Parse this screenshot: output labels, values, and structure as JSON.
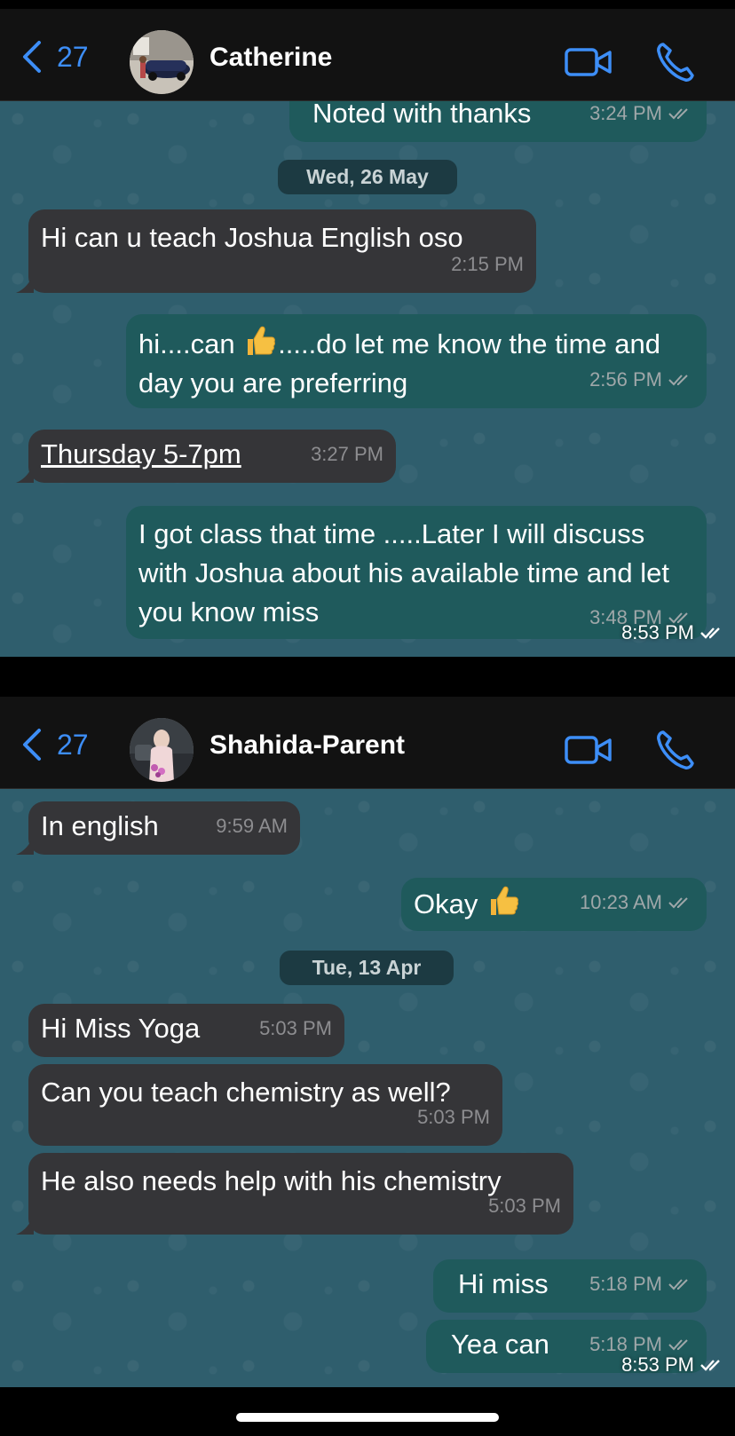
{
  "colors": {
    "accent": "#3d8ef7",
    "header_bg": "#121212",
    "chat_bg": "#2f5e6d",
    "incoming_bubble": "#353538",
    "outgoing_bubble": "#1f5a5c",
    "date_chip": "#1c3a42"
  },
  "icons": {
    "back": "chevron-left-icon",
    "video": "video-camera-icon",
    "call": "phone-icon",
    "read": "double-check-icon",
    "thumbs_up": "thumbs-up-emoji"
  },
  "screenshot_time": "8:53 PM",
  "chats": [
    {
      "back_count": "27",
      "contact_name": "Catherine",
      "messages": [
        {
          "dir": "out",
          "text": "Noted with thanks",
          "time": "3:24 PM"
        },
        {
          "date_chip": "Wed, 26 May"
        },
        {
          "dir": "in",
          "text": "Hi can u teach Joshua English oso",
          "time": "2:15 PM"
        },
        {
          "dir": "out",
          "text_before_emoji": "hi....can ",
          "text_after_emoji": ".....do let me know the time and day you are preferring",
          "time": "2:56 PM"
        },
        {
          "dir": "in",
          "text": "Thursday 5-7pm",
          "time": "3:27 PM"
        },
        {
          "dir": "out",
          "text": "I got class that time .....Later I will discuss with Joshua about his available time and let you know miss",
          "time": "3:48 PM"
        }
      ]
    },
    {
      "back_count": "27",
      "contact_name": "Shahida-Parent",
      "messages": [
        {
          "dir": "in",
          "text": "In english",
          "time": "9:59 AM"
        },
        {
          "dir": "out",
          "text": "Okay ",
          "time": "10:23 AM"
        },
        {
          "date_chip": "Tue, 13 Apr"
        },
        {
          "dir": "in",
          "text": "Hi Miss Yoga",
          "time": "5:03 PM"
        },
        {
          "dir": "in",
          "text": "Can you teach chemistry as well?",
          "time": "5:03 PM"
        },
        {
          "dir": "in",
          "text": "He also needs help with his chemistry",
          "time": "5:03 PM"
        },
        {
          "dir": "out",
          "text": "Hi miss",
          "time": "5:18 PM"
        },
        {
          "dir": "out",
          "text": "Yea can",
          "time": "5:18 PM"
        }
      ]
    }
  ]
}
